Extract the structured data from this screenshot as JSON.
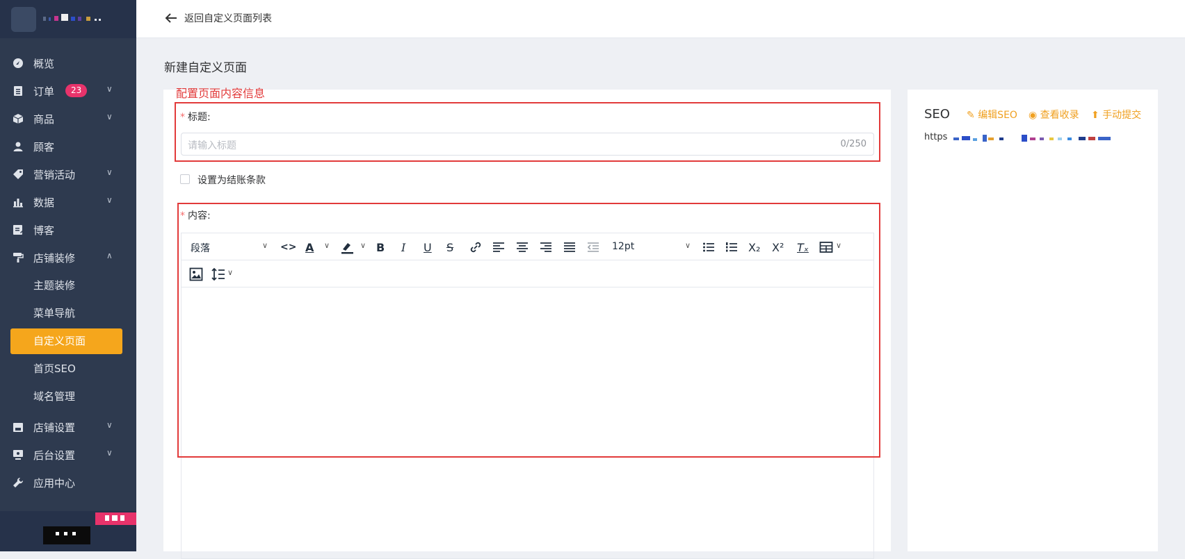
{
  "sidebar": {
    "items": [
      {
        "label": "概览",
        "icon": "dashboard-icon"
      },
      {
        "label": "订单",
        "icon": "order-icon",
        "badge": "23"
      },
      {
        "label": "商品",
        "icon": "product-icon"
      },
      {
        "label": "顾客",
        "icon": "customer-icon"
      },
      {
        "label": "营销活动",
        "icon": "tag-icon"
      },
      {
        "label": "数据",
        "icon": "chart-icon"
      },
      {
        "label": "博客",
        "icon": "blog-icon"
      },
      {
        "label": "店铺装修",
        "icon": "paint-roller-icon"
      }
    ],
    "subitems": [
      "主题装修",
      "菜单导航",
      "自定义页面",
      "首页SEO",
      "域名管理"
    ],
    "items_after": [
      {
        "label": "店铺设置",
        "icon": "store-icon"
      },
      {
        "label": "后台设置",
        "icon": "monitor-icon"
      },
      {
        "label": "应用中心",
        "icon": "wrench-icon"
      }
    ]
  },
  "topbar": {
    "back_label": "返回自定义页面列表"
  },
  "page": {
    "title": "新建自定义页面"
  },
  "annotation": {
    "label": "配置页面内容信息"
  },
  "form": {
    "required_mark": "*",
    "title_label": "标题:",
    "title_placeholder": "请输入标题",
    "title_count": "0/250",
    "checkout_label": "设置为结账条款",
    "content_label": "内容:"
  },
  "editor": {
    "block_format": "段落",
    "font_size": "12pt"
  },
  "seo": {
    "title": "SEO",
    "edit_label": "编辑SEO",
    "view_label": "查看收录",
    "submit_label": "手动提交",
    "url_prefix": "https"
  },
  "colors": {
    "accent": "#f5a61c",
    "sidebar_bg": "#2e3a4f",
    "badge": "#e8336b",
    "annotation": "#e23a3a"
  }
}
